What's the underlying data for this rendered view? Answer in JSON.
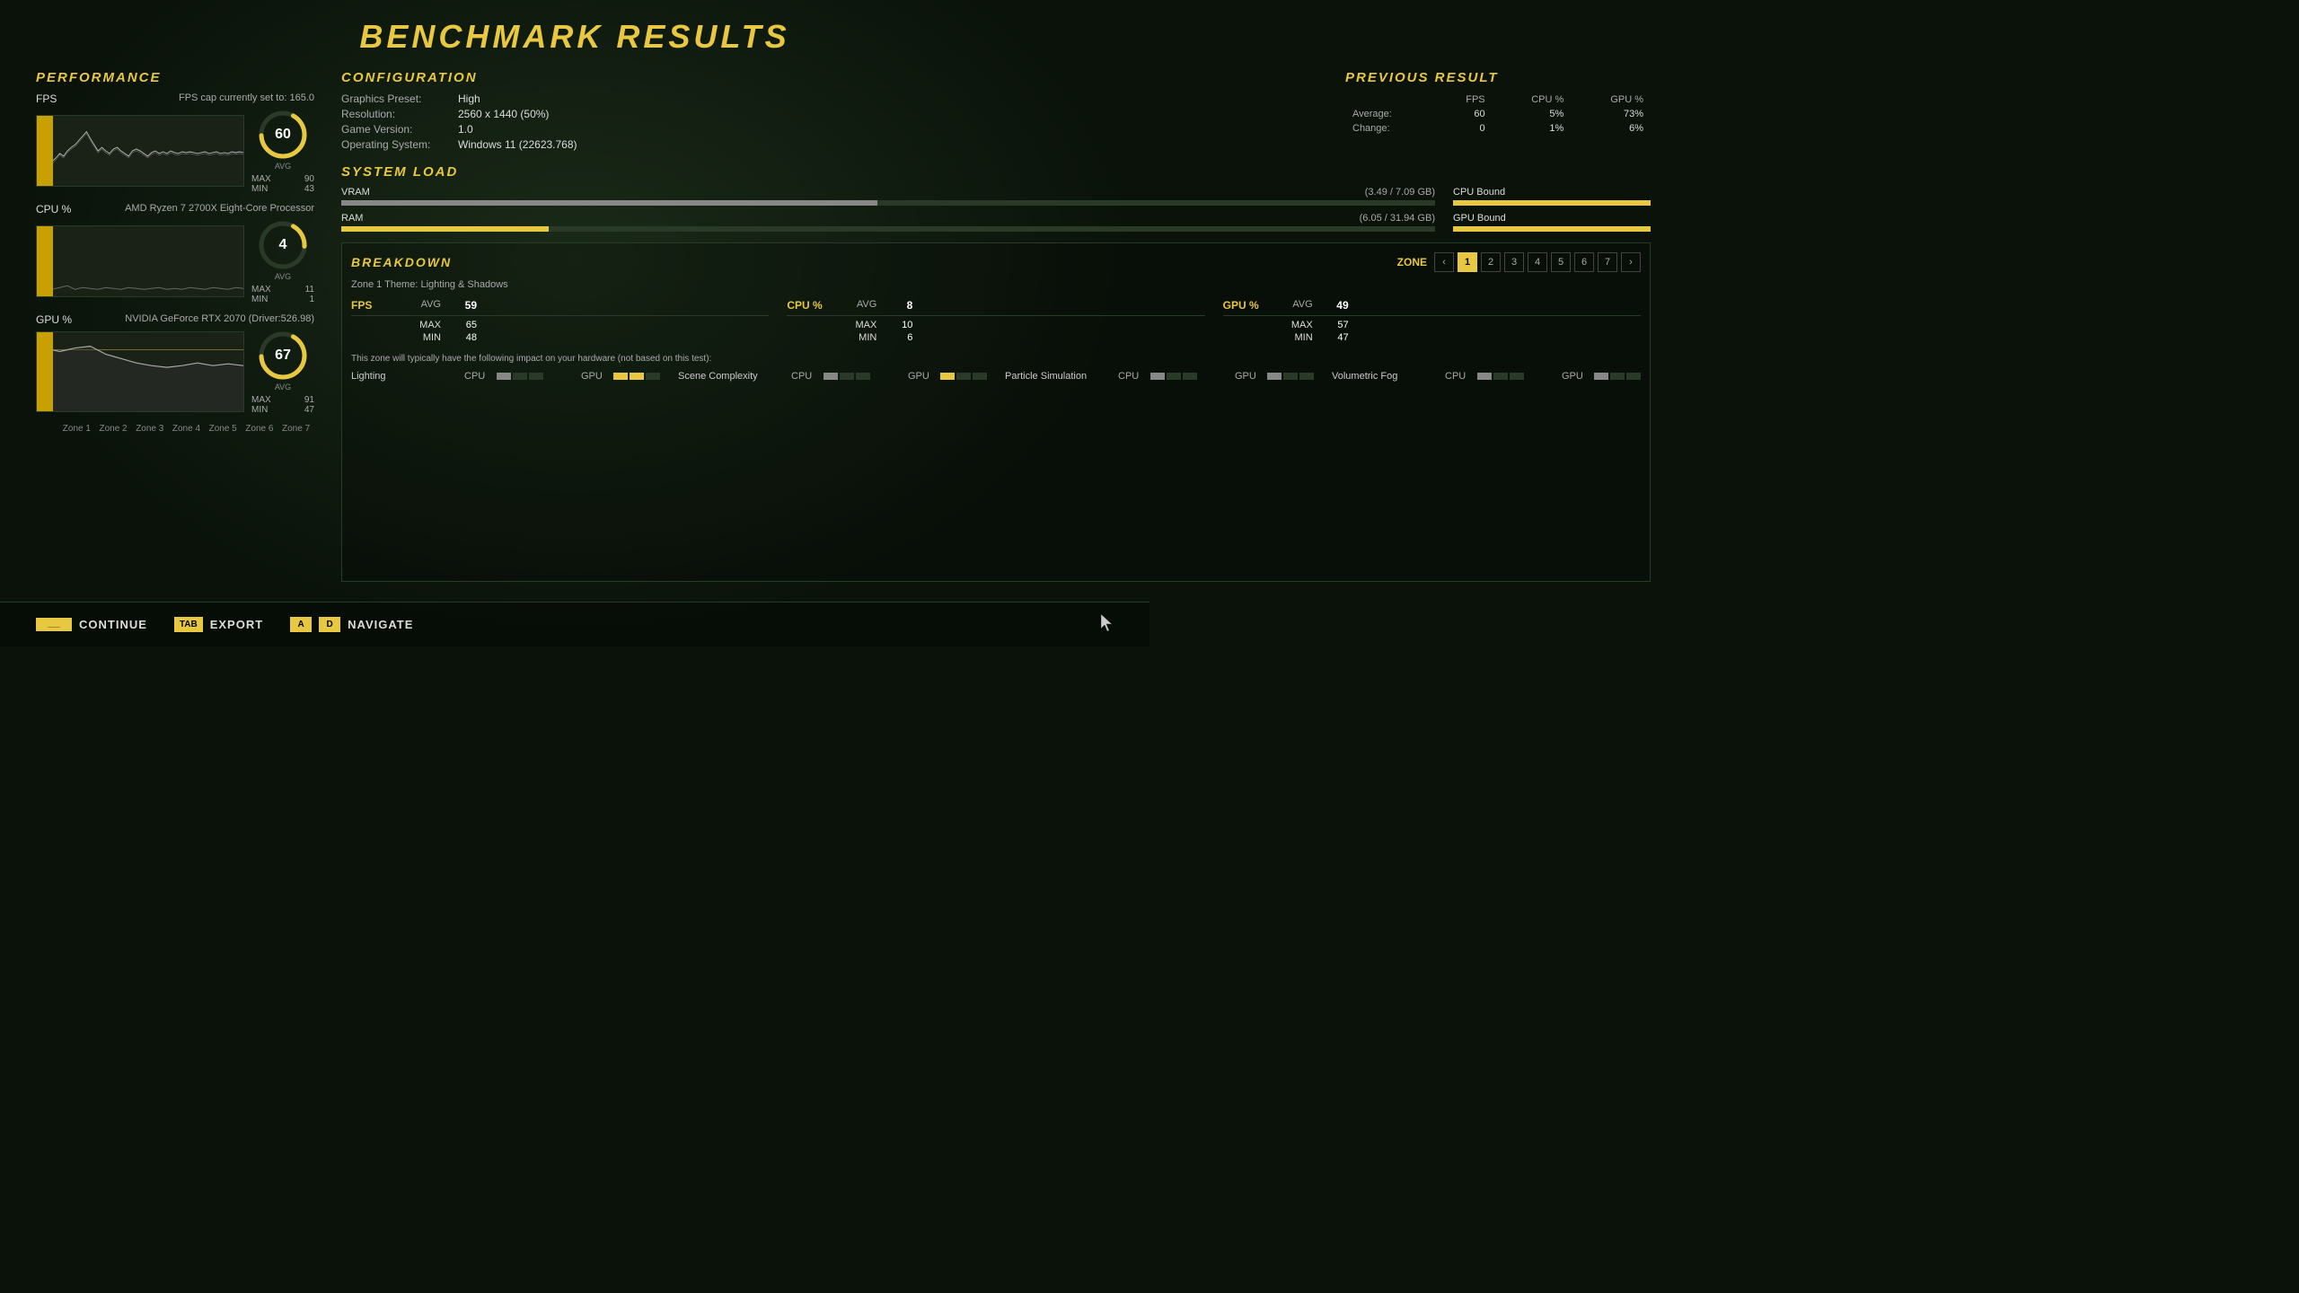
{
  "title": "BENCHMARK RESULTS",
  "performance": {
    "section_label": "PERFORMANCE",
    "fps_label": "FPS",
    "fps_cap_text": "FPS cap currently set to: 165.0",
    "fps_avg": 60,
    "fps_max": 90,
    "fps_min": 43,
    "fps_gauge_pct": 66,
    "cpu_label": "CPU %",
    "cpu_processor": "AMD Ryzen 7 2700X Eight-Core Processor",
    "cpu_avg": 4,
    "cpu_max": 11,
    "cpu_min": 1,
    "cpu_gauge_pct": 36,
    "gpu_label": "GPU %",
    "gpu_name": "NVIDIA GeForce RTX 2070 (Driver:526.98)",
    "gpu_avg": 67,
    "gpu_max": 91,
    "gpu_min": 47,
    "gpu_gauge_pct": 73,
    "zone_labels": [
      "Zone 1",
      "Zone 2",
      "Zone 3",
      "Zone 4",
      "Zone 5",
      "Zone 6",
      "Zone 7"
    ]
  },
  "configuration": {
    "section_label": "CONFIGURATION",
    "fields": [
      {
        "key": "Graphics Preset:",
        "val": "High"
      },
      {
        "key": "Resolution:",
        "val": "2560 x 1440 (50%)"
      },
      {
        "key": "Game Version:",
        "val": "1.0"
      },
      {
        "key": "Operating System:",
        "val": "Windows 11 (22623.768)"
      }
    ]
  },
  "previous_result": {
    "section_label": "PREVIOUS RESULT",
    "columns": [
      "",
      "FPS",
      "CPU %",
      "GPU %"
    ],
    "rows": [
      {
        "label": "Average:",
        "fps": "60",
        "cpu": "5%",
        "gpu": "73%"
      },
      {
        "label": "Change:",
        "fps": "0",
        "cpu": "1%",
        "gpu": "6%"
      }
    ]
  },
  "system_load": {
    "section_label": "SYSTEM LOAD",
    "vram_label": "VRAM",
    "vram_value": "(3.49 / 7.09 GB)",
    "vram_pct": 49,
    "ram_label": "RAM",
    "ram_value": "(6.05 / 31.94 GB)",
    "ram_pct": 19,
    "cpu_bound_label": "CPU Bound",
    "gpu_bound_label": "GPU Bound",
    "cpu_bound_pct": 100,
    "gpu_bound_pct": 100
  },
  "breakdown": {
    "section_label": "BREAKDOWN",
    "zone_label": "ZONE",
    "zone_theme": "Zone 1 Theme: Lighting & Shadows",
    "active_zone": 1,
    "zones": [
      1,
      2,
      3,
      4,
      5,
      6,
      7
    ],
    "fps_label": "FPS",
    "fps_avg_label": "AVG",
    "fps_avg": 59,
    "fps_max_label": "MAX",
    "fps_max": 65,
    "fps_min_label": "MIN",
    "fps_min": 48,
    "cpu_label": "CPU %",
    "cpu_avg_label": "AVG",
    "cpu_avg": 8,
    "cpu_max_label": "MAX",
    "cpu_max": 10,
    "cpu_min_label": "MIN",
    "cpu_min": 6,
    "gpu_label": "GPU %",
    "gpu_avg_label": "AVG",
    "gpu_avg": 49,
    "gpu_max_label": "MAX",
    "gpu_max": 57,
    "gpu_min_label": "MIN",
    "gpu_min": 47,
    "impact_text": "This zone will typically have the following impact on your hardware (not based on this test):",
    "impacts": [
      {
        "name": "Lighting",
        "cpu_filled": 1,
        "gpu_filled": 2
      },
      {
        "name": "Scene Complexity",
        "cpu_filled": 1,
        "gpu_filled": 1
      },
      {
        "name": "Particle Simulation",
        "cpu_filled": 1,
        "gpu_filled": 1
      },
      {
        "name": "Volumetric Fog",
        "cpu_filled": 1,
        "gpu_filled": 1
      }
    ]
  },
  "bottom_bar": {
    "continue_key": "___",
    "continue_label": "CONTINUE",
    "export_key": "TAB",
    "export_label": "EXPORT",
    "navigate_key1": "A",
    "navigate_key2": "D",
    "navigate_label": "NAVIGATE"
  },
  "colors": {
    "yellow": "#e8c840",
    "dark_bg": "#0a120a",
    "border": "#2a3a28"
  }
}
